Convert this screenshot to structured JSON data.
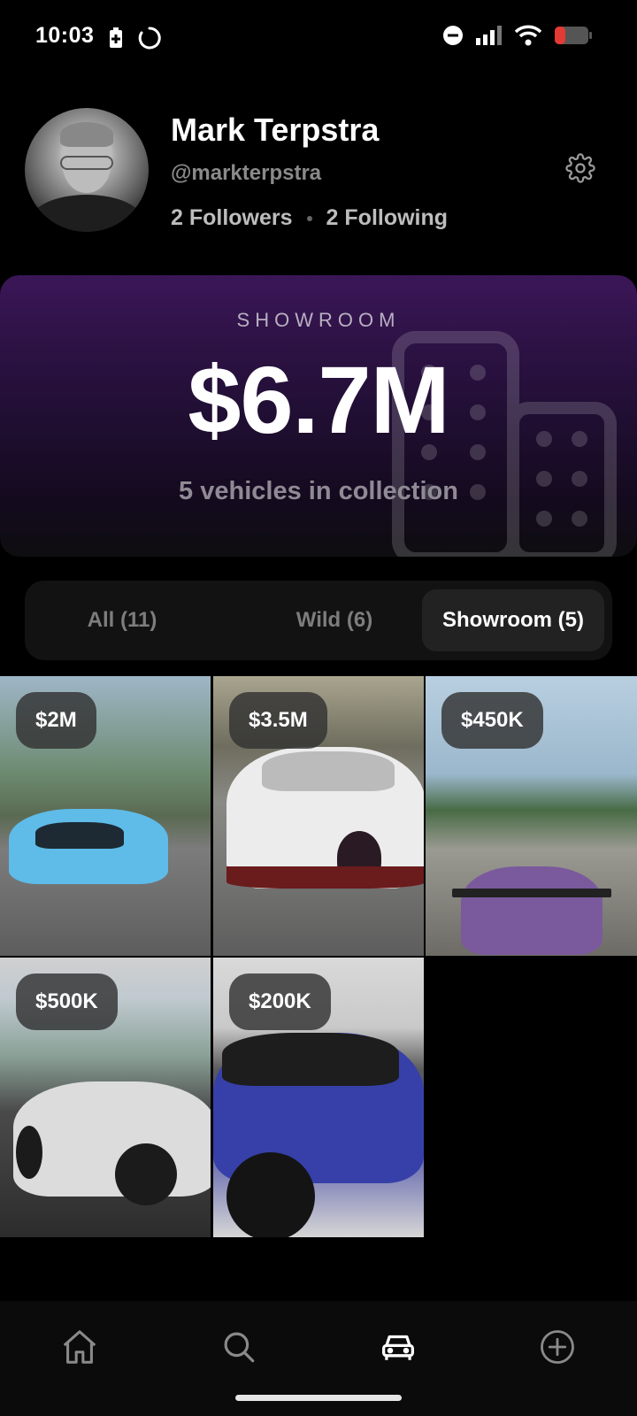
{
  "status_bar": {
    "time": "10:03",
    "icons": [
      "battery-saver-icon",
      "loading-icon",
      "dnd-icon",
      "signal-icon",
      "wifi-icon",
      "battery-icon"
    ],
    "battery_color": "#e53935"
  },
  "profile": {
    "name": "Mark Terpstra",
    "handle": "@markterpstra",
    "followers": "2 Followers",
    "following": "2 Following"
  },
  "showroom": {
    "label": "SHOWROOM",
    "value": "$6.7M",
    "subtitle": "5 vehicles in collection",
    "accent_color": "#3b1657"
  },
  "tabs": [
    {
      "label": "All (11)",
      "active": false
    },
    {
      "label": "Wild (6)",
      "active": false
    },
    {
      "label": "Showroom (5)",
      "active": true
    }
  ],
  "vehicles": [
    {
      "price": "$2M"
    },
    {
      "price": "$3.5M"
    },
    {
      "price": "$450K"
    },
    {
      "price": "$500K"
    },
    {
      "price": "$200K"
    }
  ],
  "bottom_nav": {
    "items": [
      "home-icon",
      "search-icon",
      "car-icon",
      "add-icon"
    ],
    "active": "car-icon"
  }
}
